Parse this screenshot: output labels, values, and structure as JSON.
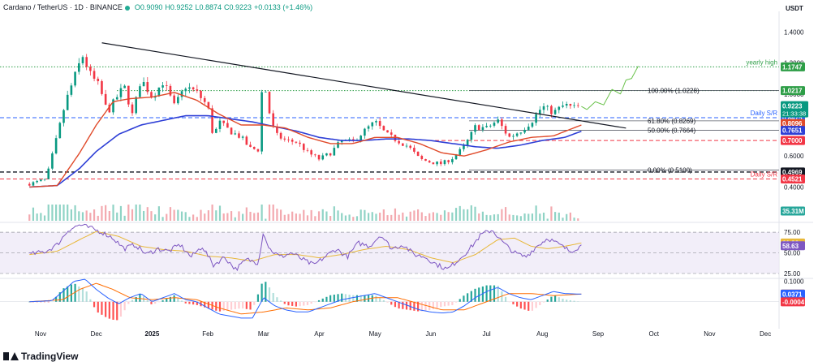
{
  "header": {
    "symbol": "Cardano / TetherUS · 1D · BINANCE",
    "open": "O0.9090",
    "high": "H0.9252",
    "low": "L0.8874",
    "close": "C0.9223",
    "change": "+0.0133 (+1.46%)"
  },
  "currency": "USDT",
  "logo": "TradingView",
  "colors": {
    "up": "#089981",
    "down": "#f23645",
    "ema50": "#e04a2a",
    "ema200": "#2e3fd6",
    "rsi": "#7e57c2",
    "rsi_ma": "#e8b83a",
    "macd": "#2962ff",
    "signal": "#ff6d00",
    "level_green": "#2e9e47",
    "level_blue": "#2962ff",
    "level_red": "#f23645",
    "dark": "#131722",
    "forecast": "#69c24a"
  },
  "chart_data": [
    {
      "type": "line",
      "name": "price",
      "x_ticks": [
        "Nov",
        "Dec",
        "2025",
        "Feb",
        "Mar",
        "Apr",
        "May",
        "Jun",
        "Jul",
        "Aug",
        "Sep",
        "Oct",
        "Nov",
        "Dec"
      ],
      "x_tick_pos": [
        0,
        1,
        2,
        3,
        4,
        5,
        6,
        7,
        8,
        9,
        10,
        11,
        12,
        13
      ],
      "y_ticks": [
        1.4,
        1.2,
        1.0,
        0.8,
        0.6,
        0.4
      ],
      "ylim": [
        0.35,
        1.47
      ],
      "close_anchors": {
        "t": [
          -0.2,
          0.1,
          0.25,
          0.45,
          0.6,
          0.75,
          0.9,
          1.05,
          1.2,
          1.35,
          1.5,
          1.65,
          1.8,
          2.0,
          2.2,
          2.4,
          2.6,
          2.8,
          3.0,
          3.1,
          3.2,
          3.4,
          3.6,
          3.75,
          3.9,
          4.0,
          4.05,
          4.2,
          4.4,
          4.6,
          4.8,
          5.0,
          5.2,
          5.4,
          5.6,
          5.8,
          6.0,
          6.2,
          6.4,
          6.6,
          6.8,
          7.0,
          7.2,
          7.4,
          7.6,
          7.8,
          8.0,
          8.2,
          8.4,
          8.6,
          8.8,
          9.0,
          9.2,
          9.4,
          9.55,
          9.7
        ],
        "v": [
          0.42,
          0.45,
          0.66,
          0.95,
          1.1,
          1.25,
          1.12,
          1.05,
          0.88,
          0.97,
          1.05,
          0.86,
          1.1,
          0.98,
          1.08,
          0.92,
          1.05,
          1.01,
          0.92,
          0.72,
          0.82,
          0.76,
          0.72,
          0.65,
          0.64,
          1.18,
          0.96,
          0.74,
          0.7,
          0.69,
          0.62,
          0.58,
          0.62,
          0.7,
          0.69,
          0.76,
          0.82,
          0.74,
          0.7,
          0.66,
          0.58,
          0.56,
          0.55,
          0.59,
          0.66,
          0.79,
          0.78,
          0.83,
          0.72,
          0.76,
          0.82,
          0.92,
          0.88,
          0.93,
          0.91,
          0.9223
        ]
      },
      "ema50_anchors": {
        "t": [
          -0.2,
          0.3,
          0.7,
          1.0,
          1.3,
          1.6,
          2.0,
          2.4,
          2.8,
          3.2,
          3.6,
          4.0,
          4.4,
          4.8,
          5.2,
          5.6,
          6.0,
          6.4,
          6.8,
          7.2,
          7.6,
          8.0,
          8.4,
          8.8,
          9.2,
          9.7
        ],
        "v": [
          0.4,
          0.41,
          0.62,
          0.8,
          0.95,
          0.97,
          0.98,
          1.01,
          0.96,
          0.87,
          0.8,
          0.8,
          0.78,
          0.72,
          0.68,
          0.68,
          0.72,
          0.72,
          0.68,
          0.62,
          0.6,
          0.64,
          0.69,
          0.72,
          0.73,
          0.8
        ]
      },
      "ema200_anchors": {
        "t": [
          -0.2,
          0.3,
          0.7,
          1.0,
          1.4,
          1.8,
          2.2,
          2.6,
          3.0,
          3.4,
          3.8,
          4.2,
          4.6,
          5.0,
          5.4,
          5.8,
          6.2,
          6.6,
          7.0,
          7.4,
          7.8,
          8.2,
          8.6,
          9.0,
          9.4,
          9.7
        ],
        "v": [
          0.4,
          0.41,
          0.52,
          0.63,
          0.74,
          0.8,
          0.83,
          0.86,
          0.86,
          0.84,
          0.82,
          0.79,
          0.76,
          0.72,
          0.7,
          0.7,
          0.71,
          0.71,
          0.7,
          0.68,
          0.66,
          0.65,
          0.67,
          0.7,
          0.72,
          0.76
        ]
      },
      "forecast_anchors": {
        "t": [
          9.7,
          9.8,
          9.95,
          10.1,
          10.25,
          10.4,
          10.5,
          10.6,
          10.72
        ],
        "v": [
          0.92,
          0.9,
          0.95,
          0.93,
          1.03,
          1.0,
          1.09,
          1.1,
          1.18
        ]
      },
      "trendline": {
        "t": [
          1.1,
          10.5
        ],
        "v": [
          1.33,
          0.78
        ]
      },
      "levels": [
        {
          "value": 1.1747,
          "label": "yearly high",
          "badge": "1.1747",
          "color": "#2e9e47",
          "style": "dotted",
          "from": 0.0,
          "to": 1.0
        },
        {
          "value": 1.0217,
          "label": "",
          "badge": "1.0217",
          "color": "#2e9e47",
          "style": "dotted",
          "from": 0.15,
          "to": 1.0
        },
        {
          "value": 0.8475,
          "label": "Daily S/R",
          "badge": "0.8475",
          "color": "#2962ff",
          "style": "dashed",
          "from": 0.0,
          "to": 1.0
        },
        {
          "value": 0.7,
          "label": "",
          "badge": "0.7000",
          "color": "#f23645",
          "style": "dashed",
          "from": 0.55,
          "to": 1.0
        },
        {
          "value": 0.4969,
          "label": "",
          "badge": "0.4969",
          "color": "#131722",
          "style": "dashed",
          "from": 0.0,
          "to": 1.0
        },
        {
          "value": 0.4521,
          "label": "Daily S/R",
          "badge": "0.4521",
          "color": "#f23645",
          "style": "dashed",
          "from": 0.0,
          "to": 1.0
        }
      ],
      "fib": [
        {
          "value": 1.0228,
          "label": "100.00% (1.0228)"
        },
        {
          "value": 0.8269,
          "label": "61.80% (0.8269)"
        },
        {
          "value": 0.7664,
          "label": "50.00% (0.7664)"
        },
        {
          "value": 0.51,
          "label": "0.00% (0.5100)"
        }
      ],
      "price_badge": {
        "value": 0.9223,
        "label": "0.9223",
        "countdown": "21:33:38"
      },
      "ema_badges": [
        {
          "value": 0.8096,
          "label": "0.8096",
          "color": "#e04a2a"
        },
        {
          "value": 0.7651,
          "label": "0.7651",
          "color": "#2e3fd6"
        }
      ],
      "volume_badge": "35.31M"
    },
    {
      "type": "line",
      "name": "RSI",
      "y_ticks": [
        75.0,
        50.0,
        25.0
      ],
      "ylim": [
        20,
        85
      ],
      "badges": [
        {
          "value": 61.96,
          "label": "61.96",
          "color": "#e8b83a"
        },
        {
          "value": 58.63,
          "label": "58.63",
          "color": "#7e57c2"
        }
      ],
      "rsi_anchors": {
        "t": [
          -0.2,
          0.1,
          0.3,
          0.5,
          0.7,
          0.9,
          1.1,
          1.3,
          1.5,
          1.7,
          1.9,
          2.1,
          2.3,
          2.5,
          2.7,
          2.9,
          3.1,
          3.3,
          3.5,
          3.7,
          3.9,
          4.0,
          4.1,
          4.3,
          4.5,
          4.7,
          4.9,
          5.1,
          5.3,
          5.5,
          5.7,
          5.9,
          6.1,
          6.3,
          6.5,
          6.7,
          6.9,
          7.1,
          7.3,
          7.5,
          7.7,
          7.9,
          8.1,
          8.3,
          8.5,
          8.7,
          8.9,
          9.1,
          9.3,
          9.5,
          9.7
        ],
        "v": [
          48,
          52,
          60,
          78,
          84,
          80,
          75,
          68,
          55,
          60,
          48,
          55,
          52,
          60,
          45,
          58,
          35,
          45,
          30,
          42,
          38,
          76,
          55,
          45,
          50,
          42,
          35,
          45,
          55,
          45,
          62,
          58,
          72,
          55,
          60,
          48,
          45,
          36,
          30,
          42,
          55,
          72,
          78,
          62,
          50,
          45,
          58,
          68,
          60,
          52,
          58.63
        ]
      },
      "rsi_ma_anchors": {
        "t": [
          -0.2,
          0.3,
          0.7,
          1.0,
          1.4,
          1.8,
          2.2,
          2.6,
          3.0,
          3.4,
          3.8,
          4.2,
          4.6,
          5.0,
          5.4,
          5.8,
          6.2,
          6.6,
          7.0,
          7.4,
          7.8,
          8.2,
          8.5,
          8.8,
          9.1,
          9.4,
          9.7
        ],
        "v": [
          48,
          52,
          66,
          76,
          70,
          58,
          54,
          52,
          46,
          44,
          40,
          48,
          48,
          44,
          48,
          54,
          58,
          54,
          44,
          38,
          48,
          66,
          68,
          58,
          55,
          58,
          61.96
        ]
      }
    },
    {
      "type": "bar",
      "name": "MACD",
      "y_ticks": [
        0.1
      ],
      "ylim": [
        -0.12,
        0.11
      ],
      "badges": [
        {
          "value": 0.0374,
          "label": "0.0374",
          "color": "#ff6d00"
        },
        {
          "value": 0.0371,
          "label": "0.0371",
          "color": "#2962ff"
        },
        {
          "value": -0.0004,
          "label": "-0.0004",
          "color": "#f23645"
        }
      ],
      "macd_anchors": {
        "t": [
          -0.2,
          0.2,
          0.4,
          0.6,
          0.8,
          1.0,
          1.2,
          1.4,
          1.6,
          1.8,
          2.0,
          2.2,
          2.4,
          2.6,
          2.8,
          3.0,
          3.2,
          3.4,
          3.6,
          3.8,
          4.0,
          4.2,
          4.4,
          4.6,
          4.8,
          5.0,
          5.2,
          5.4,
          5.6,
          5.8,
          6.0,
          6.2,
          6.4,
          6.6,
          6.8,
          7.0,
          7.2,
          7.4,
          7.6,
          7.8,
          8.0,
          8.2,
          8.4,
          8.6,
          8.8,
          9.0,
          9.2,
          9.4,
          9.7
        ],
        "v": [
          0.0,
          0.005,
          0.05,
          0.1,
          0.11,
          0.06,
          0.02,
          -0.01,
          0.02,
          0.04,
          0.0,
          0.02,
          0.04,
          0.01,
          0.0,
          -0.03,
          -0.06,
          -0.07,
          -0.08,
          -0.08,
          0.02,
          -0.02,
          -0.04,
          -0.05,
          -0.05,
          -0.03,
          -0.01,
          0.01,
          0.02,
          0.03,
          0.04,
          0.02,
          0.0,
          -0.02,
          -0.04,
          -0.05,
          -0.055,
          -0.05,
          -0.02,
          0.02,
          0.05,
          0.07,
          0.04,
          0.02,
          0.01,
          0.03,
          0.05,
          0.04,
          0.0371
        ]
      },
      "signal_anchors": {
        "t": [
          -0.2,
          0.4,
          0.7,
          1.0,
          1.3,
          1.6,
          2.0,
          2.4,
          2.8,
          3.2,
          3.6,
          4.0,
          4.4,
          4.8,
          5.2,
          5.6,
          6.0,
          6.4,
          6.8,
          7.2,
          7.6,
          8.0,
          8.4,
          8.8,
          9.2,
          9.7
        ],
        "v": [
          0.0,
          0.01,
          0.06,
          0.09,
          0.06,
          0.02,
          0.01,
          0.02,
          0.01,
          -0.03,
          -0.06,
          -0.05,
          -0.03,
          -0.04,
          -0.03,
          0.0,
          0.02,
          0.02,
          -0.01,
          -0.04,
          -0.04,
          0.0,
          0.04,
          0.04,
          0.03,
          0.0374
        ]
      }
    }
  ]
}
